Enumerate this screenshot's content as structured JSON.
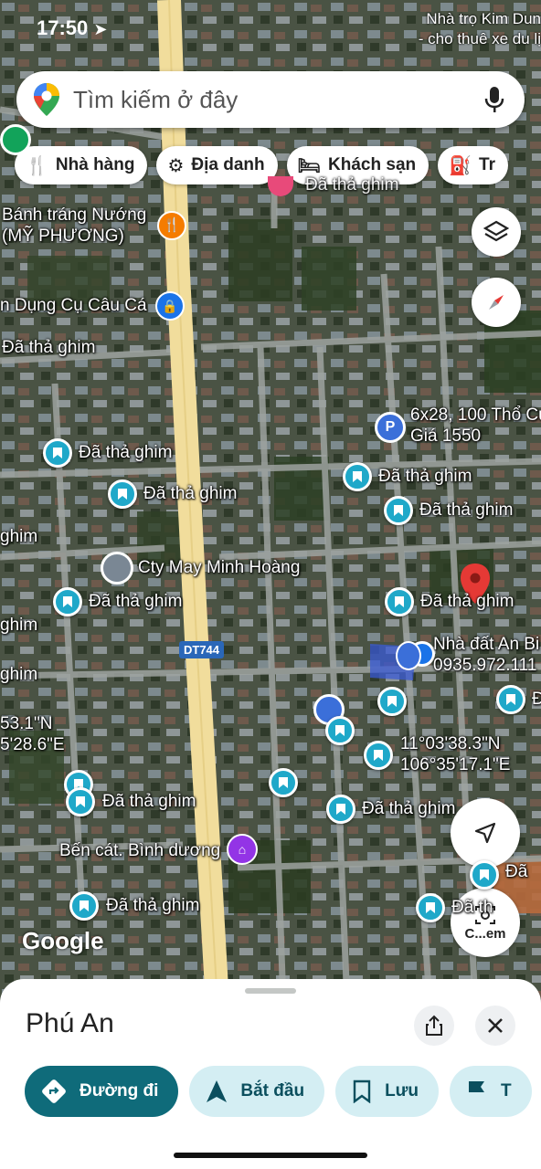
{
  "status_bar": {
    "time": "17:50"
  },
  "top_label": {
    "line1": "Nhà trọ Kim Dun",
    "line2": "- cho thuê xe du lị"
  },
  "search": {
    "placeholder": "Tìm kiếm ở đây"
  },
  "categories": [
    {
      "label": "Nhà hàng",
      "icon": "fork-knife-icon"
    },
    {
      "label": "Địa danh",
      "icon": "landmark-icon"
    },
    {
      "label": "Khách sạn",
      "icon": "bed-icon"
    },
    {
      "label": "Tr",
      "icon": "gas-station-icon"
    }
  ],
  "map": {
    "road_label": "DT744",
    "watermark": "Google",
    "labels": {
      "banh_trang_1": "Bánh tráng Nướng",
      "banh_trang_2": "(MỸ PHƯƠNG)",
      "dung_cu": "n Dụng Cụ Câu Cá",
      "da_tha_ghim": "Đã thả ghim",
      "lot_1": "6x28, 100 Thổ Cư",
      "lot_2": "Giá 1550",
      "cty_may": "Cty May Minh Hoàng",
      "nha_dat_1": "Nhà đất An Bi",
      "nha_dat_2": "0935.972.111",
      "coord_left_1": "53.1\"N",
      "coord_left_2": "5'28.6\"E",
      "coord_1": "11°03'38.3\"N",
      "coord_2": "106°35'17.1\"E",
      "ghim_partial": "ghim",
      "ghim_partial2": "ghim",
      "da_partial": "Đã",
      "da_th_partial": "Đã th",
      "ben_cat": "Bến cát. Bình dương",
      "c_em": "C...em",
      "dai_partial": "Đ",
      "ghim_right": "ghim"
    }
  },
  "sheet": {
    "place_name": "Phú An",
    "actions": [
      {
        "label": "Đường đi",
        "icon": "directions-icon"
      },
      {
        "label": "Bắt đầu",
        "icon": "navigation-arrow-icon"
      },
      {
        "label": "Lưu",
        "icon": "bookmark-icon"
      },
      {
        "label": "T",
        "icon": "flag-icon"
      }
    ]
  },
  "colors": {
    "accent": "#0f6b7a",
    "pin": "#1fa8c9",
    "red_pin": "#e53935",
    "road": "#f3dfa0"
  }
}
